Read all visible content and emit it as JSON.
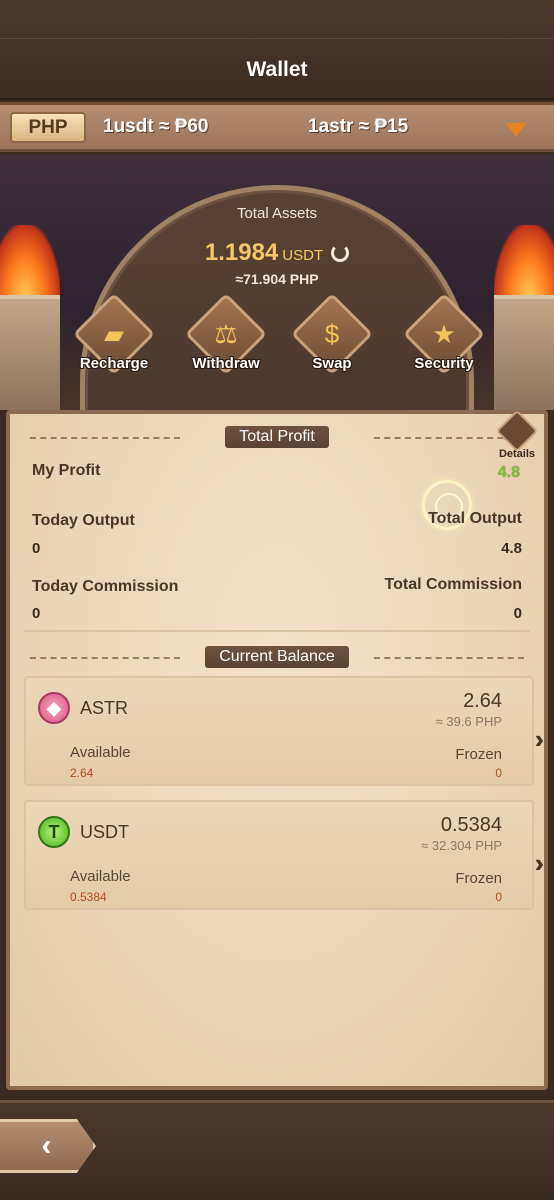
{
  "header": {
    "title": "Wallet"
  },
  "rates": {
    "currency": "PHP",
    "usdt_rate": "1usdt ≈ ₱60",
    "astr_rate": "1astr ≈ ₱15"
  },
  "assets": {
    "label": "Total Assets",
    "value": "1.1984",
    "unit": "USDT",
    "php": "≈71.904",
    "php_unit": "PHP"
  },
  "actions": [
    {
      "label": "Recharge",
      "icon": "gold-bars-icon"
    },
    {
      "label": "Withdraw",
      "icon": "scales-icon"
    },
    {
      "label": "Swap",
      "icon": "money-bag-icon"
    },
    {
      "label": "Security",
      "icon": "shield-icon"
    }
  ],
  "profit": {
    "section_title": "Total Profit",
    "details_label": "Details",
    "my_profit_label": "My Profit",
    "my_profit_value": "4.8",
    "today_output_label": "Today Output",
    "today_output_value": "0",
    "total_output_label": "Total Output",
    "total_output_value": "4.8",
    "today_commission_label": "Today Commission",
    "today_commission_value": "0",
    "total_commission_label": "Total Commission",
    "total_commission_value": "0"
  },
  "balance": {
    "section_title": "Current Balance",
    "coins": [
      {
        "name": "ASTR",
        "amount": "2.64",
        "php": "≈ 39.6 PHP",
        "available_label": "Available",
        "available": "2.64",
        "frozen_label": "Frozen",
        "frozen": "0"
      },
      {
        "name": "USDT",
        "amount": "0.5384",
        "php": "≈ 32.304 PHP",
        "available_label": "Available",
        "available": "0.5384",
        "frozen_label": "Frozen",
        "frozen": "0"
      }
    ]
  }
}
